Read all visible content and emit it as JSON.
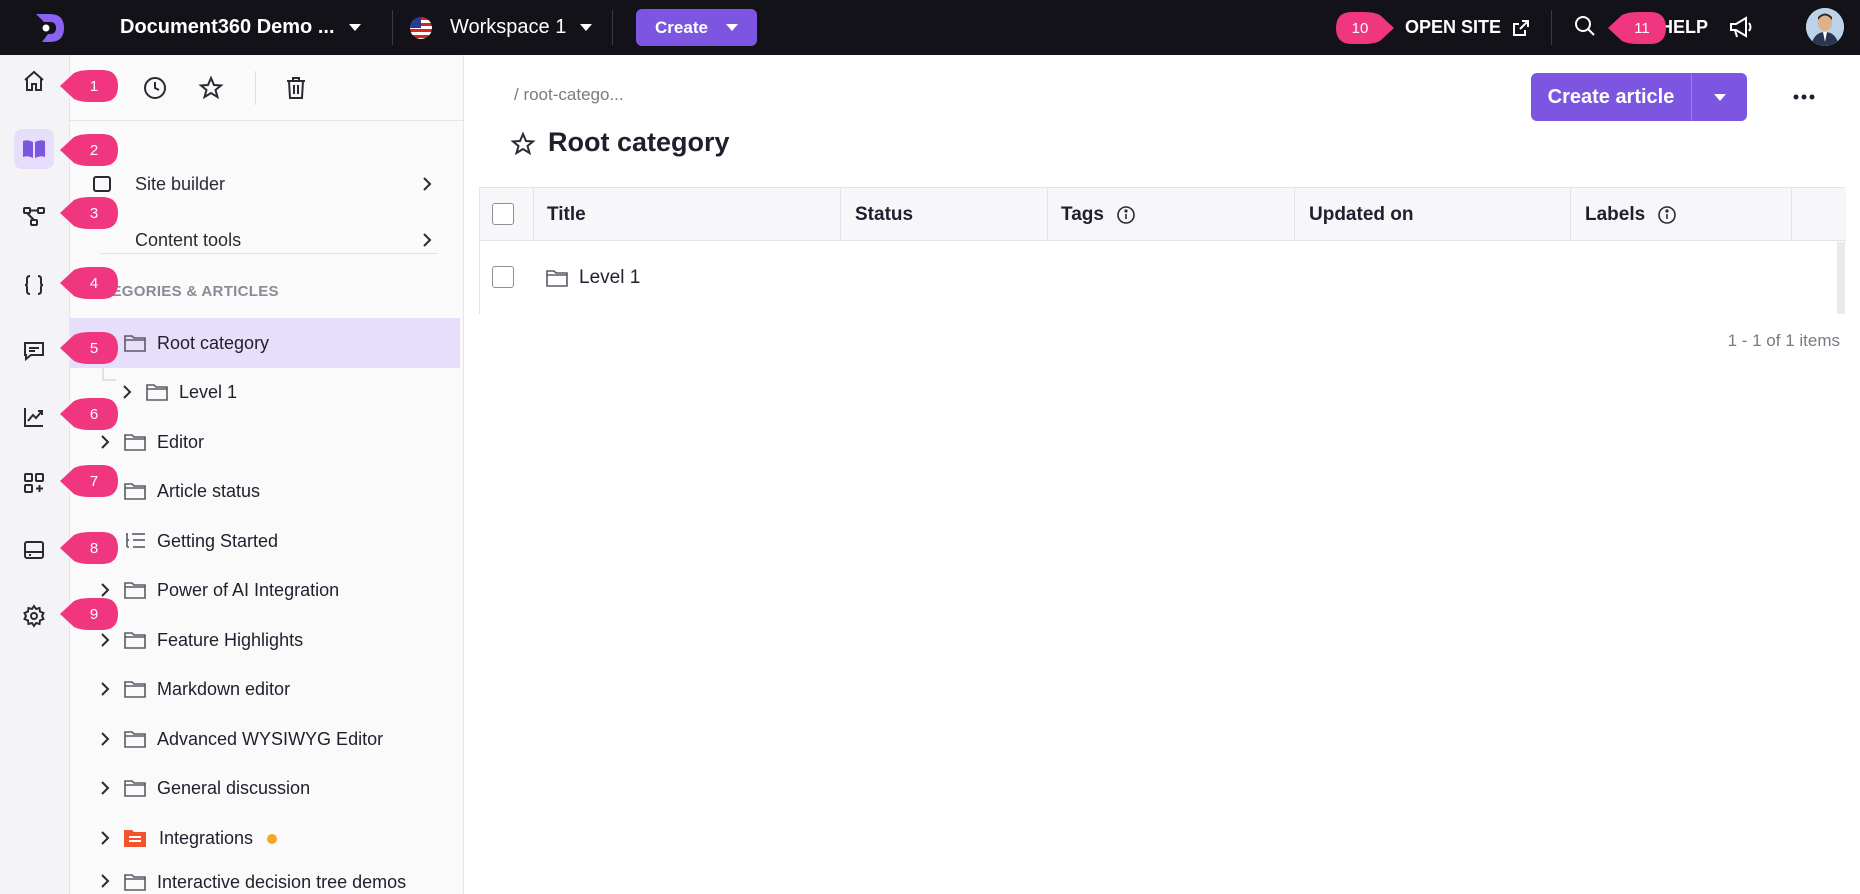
{
  "topbar": {
    "project": "Document360 Demo ...",
    "workspace": "Workspace 1",
    "create": "Create",
    "open_site": "OPEN SITE",
    "help": "HELP"
  },
  "sidebar": {
    "links": [
      {
        "label": "Site builder"
      },
      {
        "label": "Content tools"
      }
    ],
    "heading": "TEGORIES & ARTICLES",
    "tree": [
      {
        "label": "Root category"
      },
      {
        "label": "Level 1"
      },
      {
        "label": "Editor"
      },
      {
        "label": "Article status"
      },
      {
        "label": "Getting Started"
      },
      {
        "label": "Power of AI Integration"
      },
      {
        "label": "Feature Highlights"
      },
      {
        "label": "Markdown editor"
      },
      {
        "label": "Advanced WYSIWYG Editor"
      },
      {
        "label": "General discussion"
      },
      {
        "label": "Integrations"
      },
      {
        "label": "Interactive decision tree demos"
      }
    ]
  },
  "main": {
    "breadcrumb": "/ root-catego...",
    "title": "Root category",
    "create_article": "Create article",
    "columns": [
      "Title",
      "Status",
      "Tags",
      "Updated on",
      "Labels"
    ],
    "rows": [
      {
        "title": "Level 1"
      }
    ],
    "pager": "1 - 1 of 1 items"
  },
  "callouts": [
    "1",
    "2",
    "3",
    "4",
    "5",
    "6",
    "7",
    "8",
    "9",
    "10",
    "11"
  ],
  "colors": {
    "accent": "#7c55e0",
    "topbar": "#121218",
    "callout": "#f0367f",
    "selected": "#e7defc"
  }
}
